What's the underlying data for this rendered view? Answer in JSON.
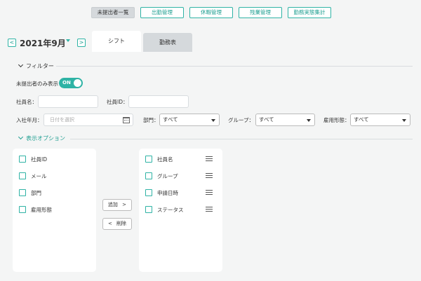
{
  "nav": [
    {
      "label": "未提出者一覧",
      "active": true
    },
    {
      "label": "出勤管理",
      "active": false
    },
    {
      "label": "休暇管理",
      "active": false
    },
    {
      "label": "残業管理",
      "active": false
    },
    {
      "label": "勤務実態集計",
      "active": false
    }
  ],
  "month": {
    "label": "2021年9月",
    "prev": "<",
    "next": ">"
  },
  "tabs": {
    "shift": "シフト",
    "attendance": "勤務表"
  },
  "filter": {
    "title": "フィルター",
    "unsubmitted_only": "未提出者のみ表示",
    "toggle": "ON",
    "employee_name": "社員名：",
    "employee_id": "社員ID：",
    "hire_date": "入社年月：",
    "hire_date_placeholder": "日付を選択",
    "department": "部門：",
    "department_value": "すべて",
    "group": "グループ：",
    "group_value": "すべて",
    "employment_type": "雇用形態：",
    "employment_type_value": "すべて"
  },
  "display_options": {
    "title": "表示オプション",
    "available": [
      "社員ID",
      "メール",
      "部門",
      "雇用形態"
    ],
    "selected": [
      "社員名",
      "グループ",
      "申請日時",
      "ステータス"
    ],
    "add": "追加",
    "add_icon": ">",
    "remove": "削除",
    "remove_icon": "<"
  },
  "colors": {
    "accent": "#2fb3a5",
    "background": "#f4f5f5"
  }
}
